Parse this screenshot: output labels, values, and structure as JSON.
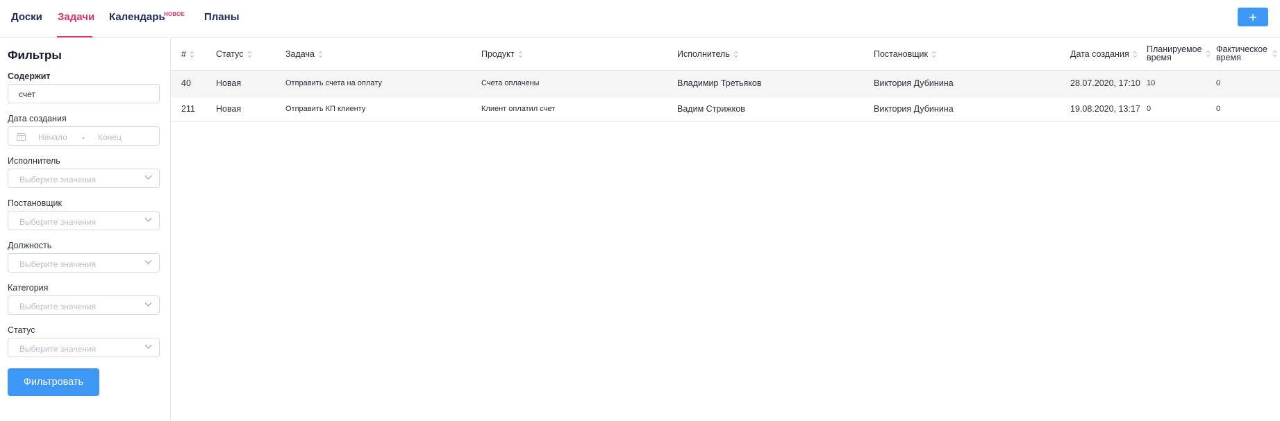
{
  "nav": {
    "tabs": [
      {
        "label": "Доски"
      },
      {
        "label": "Задачи"
      },
      {
        "label": "Календарь",
        "badge": "НОВОЕ"
      },
      {
        "label": "Планы"
      }
    ],
    "active_tab": "Задачи",
    "add_icon": "plus-icon"
  },
  "sidebar": {
    "title": "Фильтры",
    "contains": {
      "label": "Содержит",
      "value": "счет"
    },
    "created_date": {
      "label": "Дата создания",
      "start_placeholder": "Начало",
      "separator": "-",
      "end_placeholder": "Конец",
      "icon": "calendar-icon"
    },
    "executor": {
      "label": "Исполнитель",
      "placeholder": "Выберите значения"
    },
    "assigner": {
      "label": "Постановщик",
      "placeholder": "Выберите значения"
    },
    "position": {
      "label": "Должность",
      "placeholder": "Выберите значения"
    },
    "category": {
      "label": "Категория",
      "placeholder": "Выберите значения"
    },
    "status": {
      "label": "Статус",
      "placeholder": "Выберите значения"
    },
    "filter_button": "Фильтровать"
  },
  "table": {
    "columns": {
      "id": "#",
      "status": "Статус",
      "task": "Задача",
      "product": "Продукт",
      "executor": "Исполнитель",
      "assigner": "Постановщик",
      "created": "Дата создания",
      "planned": "Планируемое время",
      "actual": "Фактическое время"
    },
    "rows": [
      {
        "id": "40",
        "status": "Новая",
        "task": "Отправить счета на оплату",
        "product": "Счета оплачены",
        "executor": "Владимир Третьяков",
        "assigner": "Виктория Дубинина",
        "created": "28.07.2020, 17:10",
        "planned": "10",
        "actual": "0"
      },
      {
        "id": "211",
        "status": "Новая",
        "task": "Отправить КП клиенту",
        "product": "Клиент оплатил счет",
        "executor": "Вадим Стрижков",
        "assigner": "Виктория Дубинина",
        "created": "19.08.2020, 13:17",
        "planned": "0",
        "actual": "0"
      }
    ]
  },
  "colors": {
    "accent": "#e0336e",
    "primary": "#3d97f5",
    "nav_text": "#1d2a5c"
  }
}
